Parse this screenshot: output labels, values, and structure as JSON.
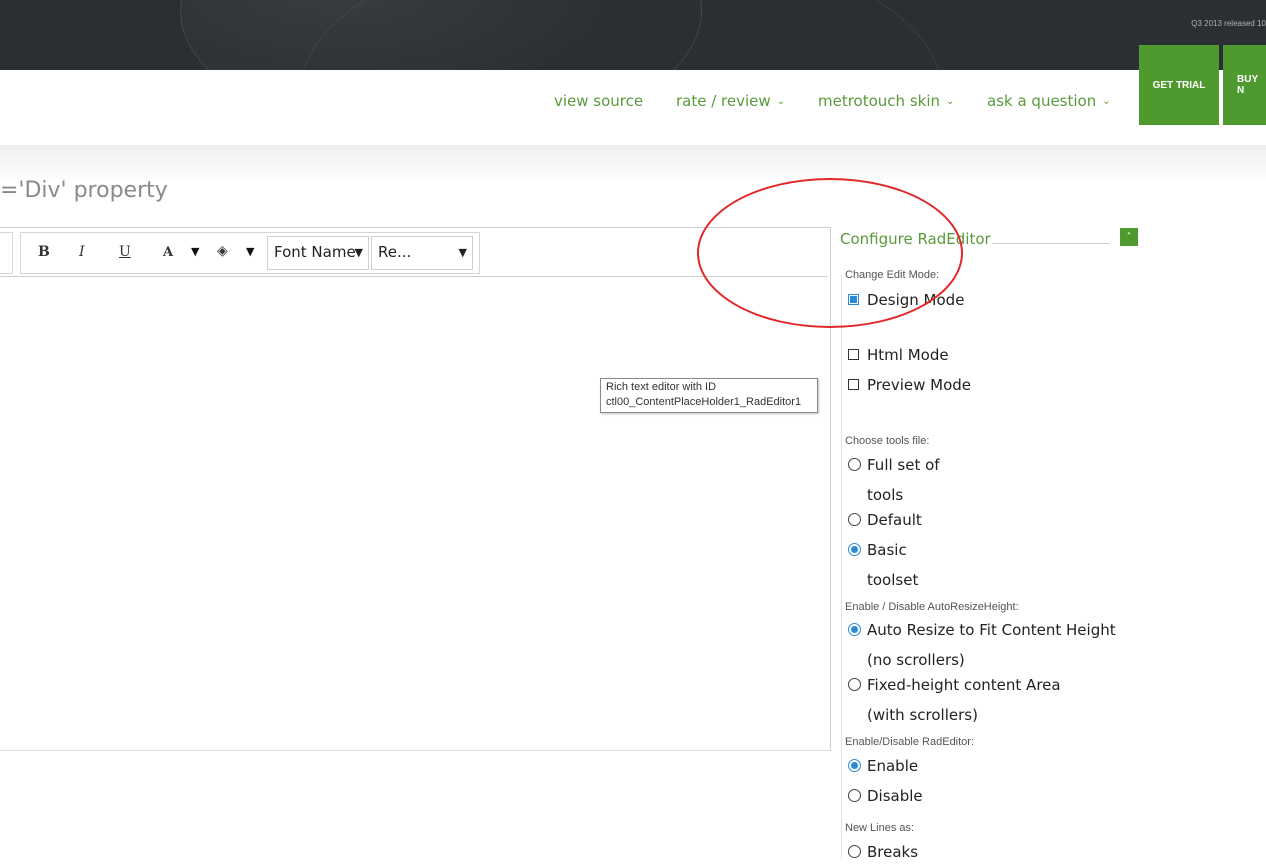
{
  "header": {
    "release_text": "Q3 2013 released 10"
  },
  "nav": {
    "items": [
      {
        "label": "view source",
        "has_dropdown": false
      },
      {
        "label": "rate / review",
        "has_dropdown": true
      },
      {
        "label": "metrotouch skin",
        "has_dropdown": true
      },
      {
        "label": "ask a question",
        "has_dropdown": true
      }
    ],
    "get_trial": "GET TRIAL",
    "buy": "BUY N"
  },
  "page": {
    "heading": "='Div' property"
  },
  "editor": {
    "toolbar": {
      "bold": "B",
      "italic": "I",
      "underline": "U",
      "fore_color": "A",
      "font_name": "Font Name",
      "real_font_size": "Re..."
    },
    "tooltip_line1": "Rich text editor with ID",
    "tooltip_line2": "ctl00_ContentPlaceHolder1_RadEditor1"
  },
  "config": {
    "title": "Configure RadEditor",
    "sections": {
      "edit_mode": {
        "label": "Change Edit Mode:",
        "design": "Design Mode",
        "html": "Html Mode",
        "preview": "Preview Mode"
      },
      "tools_file": {
        "label": "Choose tools file:",
        "full": "Full set of tools",
        "default": "Default",
        "basic": "Basic toolset"
      },
      "autoresize": {
        "label": "Enable / Disable AutoResizeHeight:",
        "auto": "Auto Resize to Fit Content Height (no scrollers)",
        "fixed": "Fixed-height content Area (with scrollers)"
      },
      "enable": {
        "label": "Enable/Disable RadEditor:",
        "enable": "Enable",
        "disable": "Disable"
      },
      "newlines": {
        "label": "New Lines as:",
        "breaks": "Breaks"
      }
    }
  },
  "colors": {
    "accent_green": "#4f9a2f",
    "link_green": "#5a9a3c",
    "header_dark": "#2b2e33",
    "selected_blue": "#2a8bd8",
    "annotation_red": "#e02828"
  }
}
